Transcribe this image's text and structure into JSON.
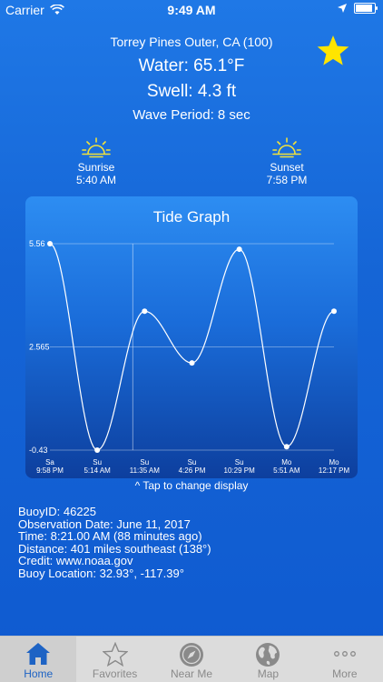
{
  "status_bar": {
    "carrier": "Carrier",
    "time": "9:49 AM"
  },
  "station": {
    "name": "Torrey Pines Outer, CA (100)",
    "water": "Water: 65.1°F",
    "swell": "Swell: 4.3 ft",
    "wave_period": "Wave Period: 8 sec"
  },
  "sunrise": {
    "label": "Sunrise",
    "time": "5:40 AM"
  },
  "sunset": {
    "label": "Sunset",
    "time": "7:58 PM"
  },
  "chart_data": {
    "type": "line",
    "title": "Tide Graph",
    "ylim": [
      -0.43,
      5.56
    ],
    "y_ticks": [
      "5.56",
      "2.565",
      "-0.43"
    ],
    "categories": [
      {
        "day": "Sa",
        "time": "9:58 PM"
      },
      {
        "day": "Su",
        "time": "5:14 AM"
      },
      {
        "day": "Su",
        "time": "11:35 AM"
      },
      {
        "day": "Su",
        "time": "4:26 PM"
      },
      {
        "day": "Su",
        "time": "10:29 PM"
      },
      {
        "day": "Mo",
        "time": "5:51 AM"
      },
      {
        "day": "Mo",
        "time": "12:17 PM"
      }
    ],
    "values": [
      5.56,
      -0.43,
      3.6,
      2.1,
      5.4,
      -0.33,
      3.6
    ],
    "current_index": 1.75,
    "grid": true
  },
  "tap_hint": "^ Tap to change display",
  "info": [
    "BuoyID: 46225",
    "Observation Date: June 11, 2017",
    "Time: 8:21.00 AM (88 minutes ago)",
    "Distance: 401 miles southeast (138°)",
    "Credit: www.noaa.gov",
    "Buoy Location: 32.93°, -117.39°"
  ],
  "tabs": [
    {
      "label": "Home",
      "icon": "home-icon",
      "active": true
    },
    {
      "label": "Favorites",
      "icon": "star-outline-icon",
      "active": false
    },
    {
      "label": "Near Me",
      "icon": "compass-icon",
      "active": false
    },
    {
      "label": "Map",
      "icon": "globe-icon",
      "active": false
    },
    {
      "label": "More",
      "icon": "more-dots-icon",
      "active": false
    }
  ],
  "colors": {
    "sun_icon": "#f2e23a",
    "star": "#ffe500",
    "tab_active": "#1e63c4"
  }
}
